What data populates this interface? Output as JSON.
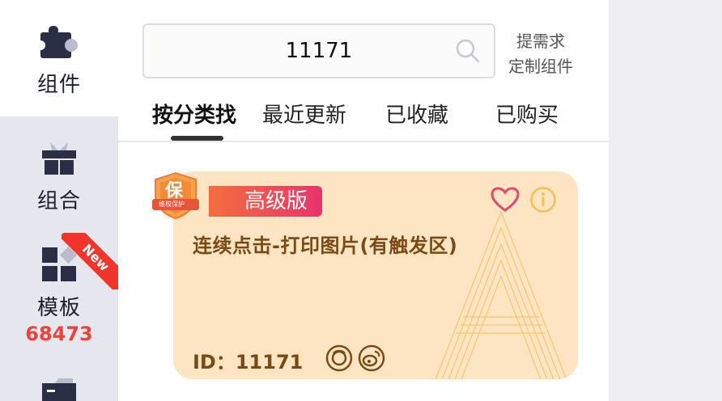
{
  "rail": {
    "items": [
      {
        "label": "组件",
        "icon": "puzzle-icon",
        "active": true
      },
      {
        "label": "组合",
        "icon": "gift-icon"
      },
      {
        "label": "模板",
        "icon": "template-icon",
        "count": "68473",
        "ribbon": "New"
      },
      {
        "label": "",
        "icon": "folder-icon"
      }
    ]
  },
  "search": {
    "value": "11171"
  },
  "custom_link": {
    "line1": "提需求",
    "line2": "定制组件"
  },
  "tabs": [
    {
      "label": "按分类找",
      "active": true
    },
    {
      "label": "最近更新"
    },
    {
      "label": "已收藏"
    },
    {
      "label": "已购买"
    }
  ],
  "card": {
    "shield_text": "保",
    "shield_subtext": "维权保护",
    "badge": "高级版",
    "title": "连续点击-打印图片(有触发区)",
    "id_text": "ID：11171",
    "watermark_letter": "A"
  },
  "colors": {
    "accent_red": "#e8443c",
    "card_bg": "#fde5c4",
    "card_text": "#7a4a14",
    "badge_gradient_start": "#f26e3d",
    "badge_gradient_end": "#e8336e"
  }
}
